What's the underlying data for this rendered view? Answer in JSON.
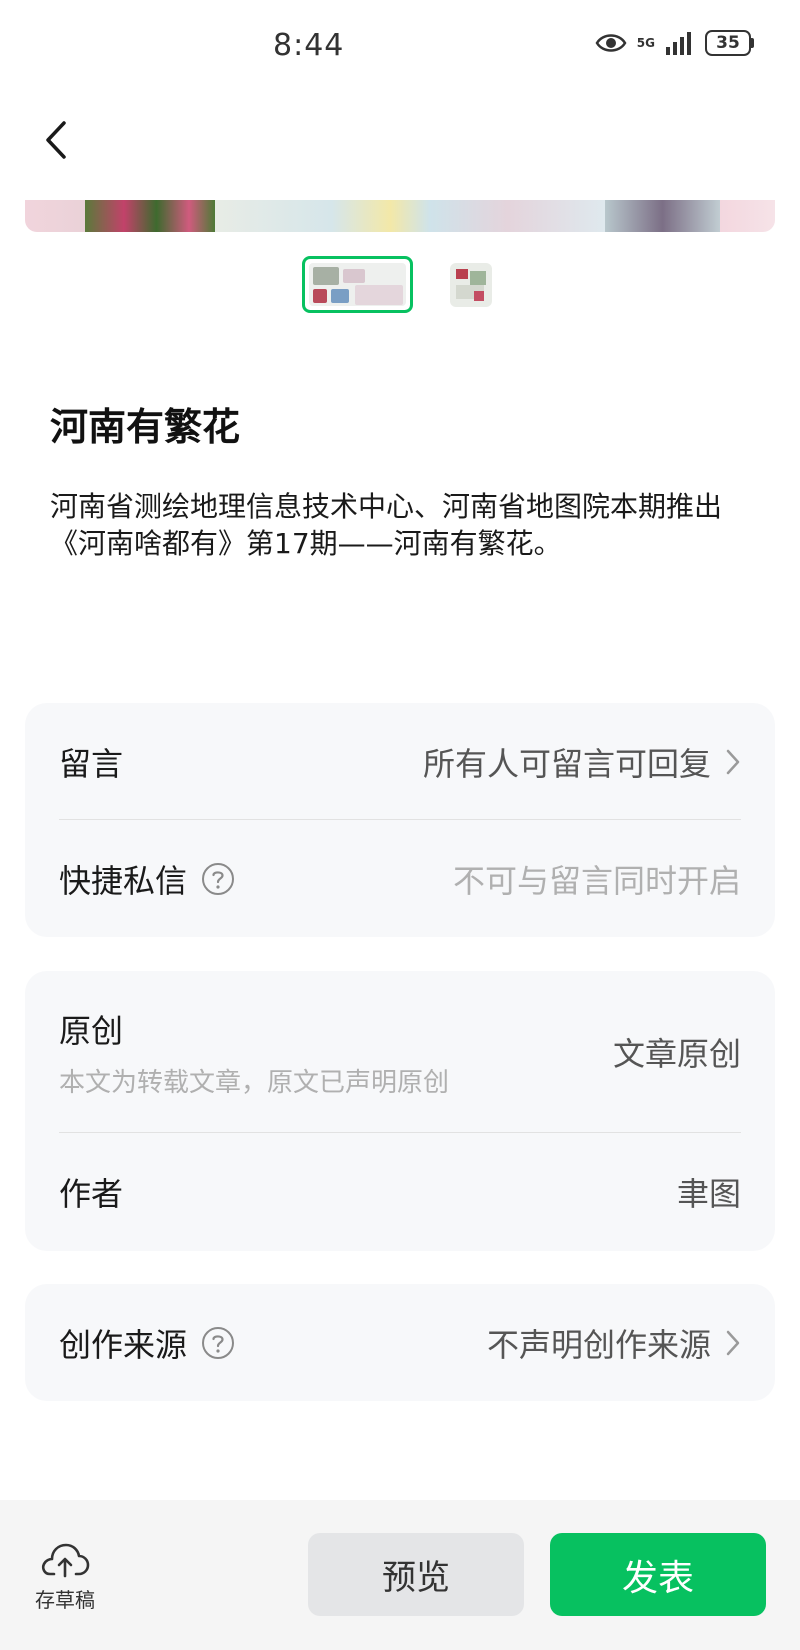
{
  "status_bar": {
    "time": "8:44",
    "network": "5G",
    "battery": "35"
  },
  "article": {
    "title": "河南有繁花",
    "description": "河南省测绘地理信息技术中心、河南省地图院本期推出《河南啥都有》第17期——河南有繁花。"
  },
  "settings": {
    "comment": {
      "label": "留言",
      "value": "所有人可留言可回复"
    },
    "quick_message": {
      "label": "快捷私信",
      "value": "不可与留言同时开启"
    },
    "original": {
      "label": "原创",
      "sub": "本文为转载文章，原文已声明原创",
      "value": "文章原创"
    },
    "author": {
      "label": "作者",
      "value": "聿图"
    },
    "creation_source": {
      "label": "创作来源",
      "value": "不声明创作来源"
    }
  },
  "bottom_bar": {
    "draft_label": "存草稿",
    "preview_label": "预览",
    "publish_label": "发表"
  },
  "colors": {
    "accent": "#07c160",
    "card_bg": "#f7f8fa",
    "muted_text": "#b0b0b0"
  }
}
